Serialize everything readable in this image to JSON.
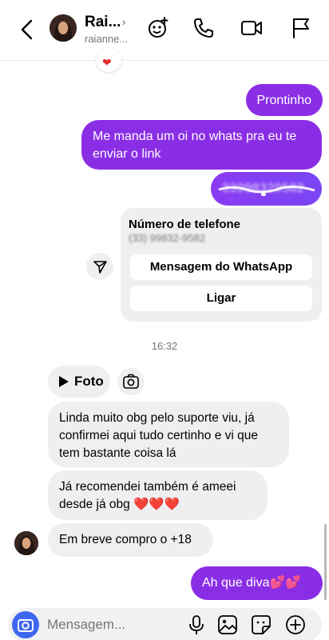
{
  "header": {
    "name": "Rai...",
    "username": "raianne...",
    "chevron": "›"
  },
  "messages": {
    "out_1": "Prontinho",
    "out_2": "Me manda um oi no whats pra eu te enviar o link",
    "out_3_blurred": "33998329582",
    "phone_card": {
      "title": "Número de telefone",
      "subtitle": "(33) 99832-9582",
      "button_whatsapp": "Mensagem do WhatsApp",
      "button_call": "Ligar"
    },
    "timestamp": "16:32",
    "foto_label": "Foto",
    "in_1": "Linda muito obg pelo suporte viu, já confirmei aqui tudo certinho e vi que tem bastante coisa lá",
    "in_2": "Já recomendei também é ameei desde já obg ❤️❤️❤️",
    "in_3": "Em breve compro o +18",
    "out_4": "Ah que diva💕💕"
  },
  "composer": {
    "placeholder": "Mensagem..."
  },
  "colors": {
    "outgoing": "#8a2ee6",
    "incoming": "#efeff2",
    "accent": "#3d67f0"
  },
  "icons": [
    "back-icon",
    "effects-icon",
    "phone-icon",
    "video-icon",
    "flag-icon",
    "share-icon",
    "camera-icon",
    "mic-icon",
    "gallery-icon",
    "sticker-icon",
    "plus-icon"
  ]
}
